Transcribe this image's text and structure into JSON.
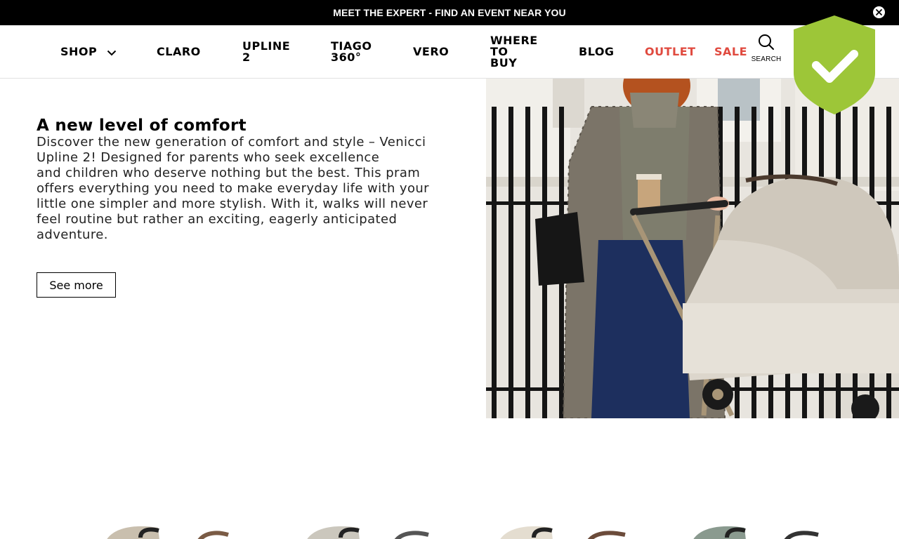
{
  "announcement": {
    "text": "MEET THE EXPERT - FIND AN EVENT NEAR YOU",
    "close_icon": "close-circle-icon"
  },
  "nav": {
    "items": [
      {
        "label": "SHOP",
        "has_dropdown": true
      },
      {
        "label": "CLARO"
      },
      {
        "label_line1": "UPLINE",
        "label_line2": "2"
      },
      {
        "label_line1": "TIAGO",
        "label_line2": "360°"
      },
      {
        "label": "VERO"
      },
      {
        "label_line1": "WHERE",
        "label_line2": "TO",
        "label_line3": "BUY"
      },
      {
        "label": "BLOG"
      },
      {
        "label": "OUTLET",
        "color": "#e04a3f"
      },
      {
        "label": "SALE",
        "color": "#e04a3f"
      }
    ],
    "search_label": "SEARCH"
  },
  "badge": {
    "icon": "shield-check-icon",
    "color": "#9dc638"
  },
  "hero": {
    "title": "A new level of comfort",
    "body_lines": [
      "Discover the new generation of comfort and style – Venicci",
      "Upline 2! Designed for parents who seek excellence",
      "and children who deserve nothing but the best. This pram",
      "offers everything you need to make everyday life with your",
      "little one simpler and more stylish. With it, walks will never",
      "feel routine but rather an exciting, eagerly anticipated",
      "adventure."
    ],
    "button_label": "See more",
    "image_alt": "woman-with-pram-photo"
  },
  "colors": {
    "accent_red": "#e04a3f",
    "badge_green": "#9dc638"
  }
}
